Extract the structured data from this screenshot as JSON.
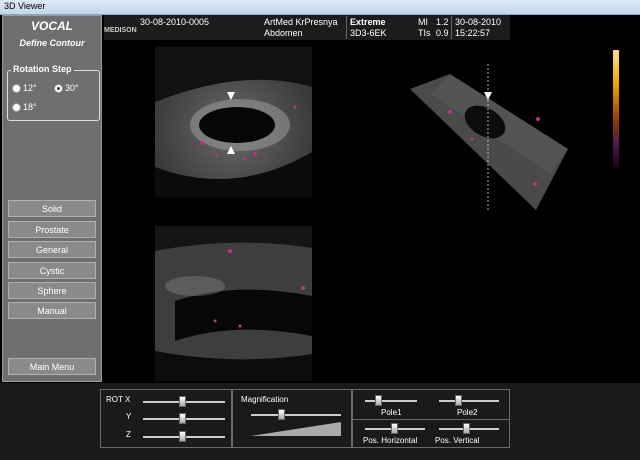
{
  "window": {
    "title": "3D Viewer"
  },
  "left_panel": {
    "title": "VOCAL",
    "subtitle": "Define Contour",
    "rotation_step": {
      "label": "Rotation Step",
      "options": [
        {
          "label": "12°",
          "selected": false
        },
        {
          "label": "30°",
          "selected": true
        },
        {
          "label": "18°",
          "selected": false
        }
      ]
    },
    "buttons": [
      "Solid",
      "Prostate",
      "General",
      "Cystic",
      "Sphere",
      "Manual"
    ],
    "main_menu": "Main Menu"
  },
  "info_bar": {
    "brand": "MEDISON",
    "patient_id": "30-08-2010-0005",
    "institution": "ArtMed KrPresnya",
    "preset": "Abdomen",
    "mode": "Extreme",
    "probe": "3D3-6EK",
    "mi_label": "MI",
    "mi_value": "1.2",
    "tis_label": "TIs",
    "tis_value": "0.9",
    "date": "30-08-2010",
    "time": "15:22:57"
  },
  "controls": {
    "rot_x": "ROT X",
    "y": "Y",
    "z": "Z",
    "magnification": "Magnification",
    "pole1": "Pole1",
    "pole2": "Pole2",
    "pos_horizontal": "Pos. Horizontal",
    "pos_vertical": "Pos. Vertical"
  },
  "colors": {
    "panel_bg": "#6f6f6f",
    "button_bg": "#8a8a8a",
    "doppler": "#c0308c"
  }
}
